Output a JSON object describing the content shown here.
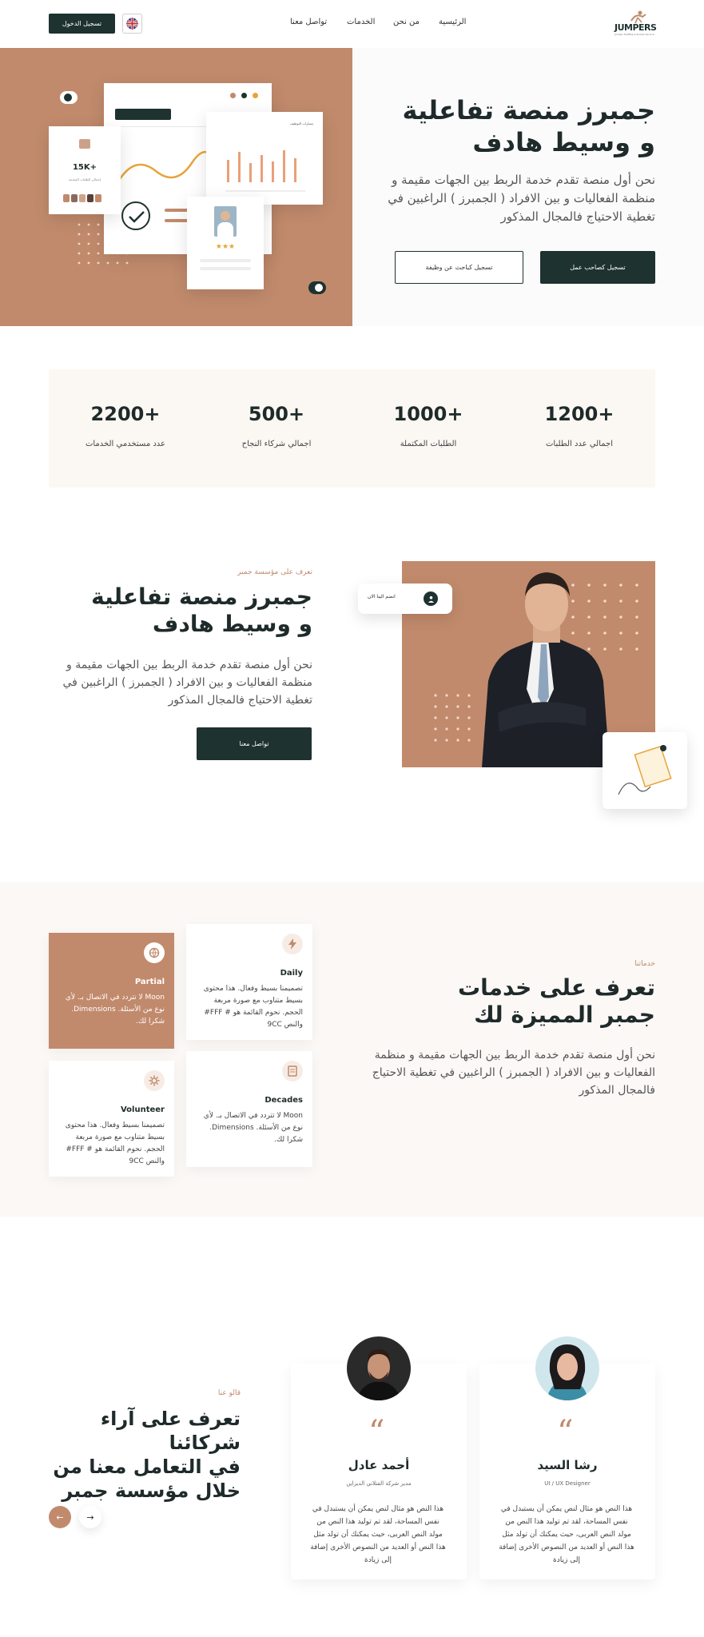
{
  "nav": {
    "login_label": "تسجيل الدخول",
    "links": [
      "الرئيسية",
      "من نحن",
      "الخدمات",
      "تواصل معنا"
    ],
    "logo_text": "JUMPERS",
    "logo_tagline": "Jumper Staffing & Events Service"
  },
  "hero": {
    "title_line1": "جمبرز منصة تفاعلية",
    "title_line2": "و وسيط هادف",
    "text": "نحن أول منصة تقدم خدمة الربط بين الجهات مقيمة و منظمة الفعاليات و بين الافراد ( الجمبرز ) الراغبين في تغطية الاحتياج فالمجال المذكور",
    "btn_employer": "تسجيل كصاحب عمل",
    "btn_seeker": "تسجيل كباحث عن وظيفة",
    "illustration": {
      "stat_value": "15K+",
      "stat_caption": "إجمالي الطلبات المقدمة",
      "chart_caption": "مسارات التوظيف",
      "stars": "★★★"
    }
  },
  "stats": [
    {
      "value": "1200+",
      "label": "اجمالي عدد الطلبات"
    },
    {
      "value": "1000+",
      "label": "الطلبات المكتملة"
    },
    {
      "value": "500+",
      "label": "اجمالي شركاء النجاح"
    },
    {
      "value": "2200+",
      "label": "عدد مستخدمي الخدمات"
    }
  ],
  "about": {
    "kicker": "تعرف على مؤسسة جمبر",
    "title_line1": "جمبرز منصة تفاعلية",
    "title_line2": "و وسيط هادف",
    "text": "نحن أول منصة تقدم خدمة الربط بين الجهات مقيمة و منظمة الفعاليات و بين الافراد ( الجمبرز ) الراغبين في تغطية الاحتياج فالمجال المذكور",
    "contact_btn": "تواصل معنا",
    "join_badge": "انضم الينا الان"
  },
  "services": {
    "kicker": "خدماتنا",
    "title_line1": "تعرف على خدمات",
    "title_line2": "جمبر المميزة لك",
    "text": "نحن أول منصة تقدم خدمة الربط بين الجهات مقيمة و منظمة الفعاليات و بين الافراد ( الجمبرز ) الراغبين في تغطية الاحتياج فالمجال المذكور",
    "cards": [
      {
        "title": "Daily",
        "body": "تصميمنا بسيط وفعال. هذا محتوى بسيط متناوب مع صورة مربعة الحجم. نحوم القائمة هو # FFF# والنص 9CC"
      },
      {
        "title": "Partial",
        "body": "Moon لا تتردد في الاتصال بـ. لأي نوع من الأسئلة. Dimensions. شكرا لك."
      },
      {
        "title": "Decades",
        "body": "Moon لا تتردد في الاتصال بـ. لأي نوع من الأسئلة. Dimensions. شكرا لك."
      },
      {
        "title": "Volunteer",
        "body": "تصميمنا بسيط وفعال. هذا محتوى بسيط متناوب مع صورة مربعة الحجم. نحوم القائمة هو # FFF# والنص 9CC"
      }
    ]
  },
  "testimonials": {
    "kicker": "قالو عنا",
    "title_line1": "تعرف على آراء شركائنا",
    "title_line2": "في التعامل معنا من",
    "title_line3": "خلال مؤسسة جمبر",
    "items": [
      {
        "name": "رشا السيد",
        "role": "UI / UX Designer",
        "body": "هذا النص هو مثال لنص يمكن أن يستبدل في نفس المساحة، لقد تم توليد هذا النص من مولد النص العربى، حيث يمكنك أن تولد مثل هذا النص أو العديد من النصوص الأخرى إضافة إلى زيادة"
      },
      {
        "name": "أحمد عادل",
        "role": "مدير شركة الفتلاني الديزاين",
        "body": "هذا النص هو مثال لنص يمكن أن يستبدل في نفس المساحة، لقد تم توليد هذا النص من مولد النص العربى، حيث يمكنك أن تولد مثل هذا النص أو العديد من النصوص الأخرى إضافة إلى زيادة"
      }
    ],
    "prev_label": "←",
    "next_label": "→"
  },
  "colors": {
    "accent": "#c18a6c",
    "dark": "#1e3230",
    "light_bg": "#fbf7f3"
  }
}
